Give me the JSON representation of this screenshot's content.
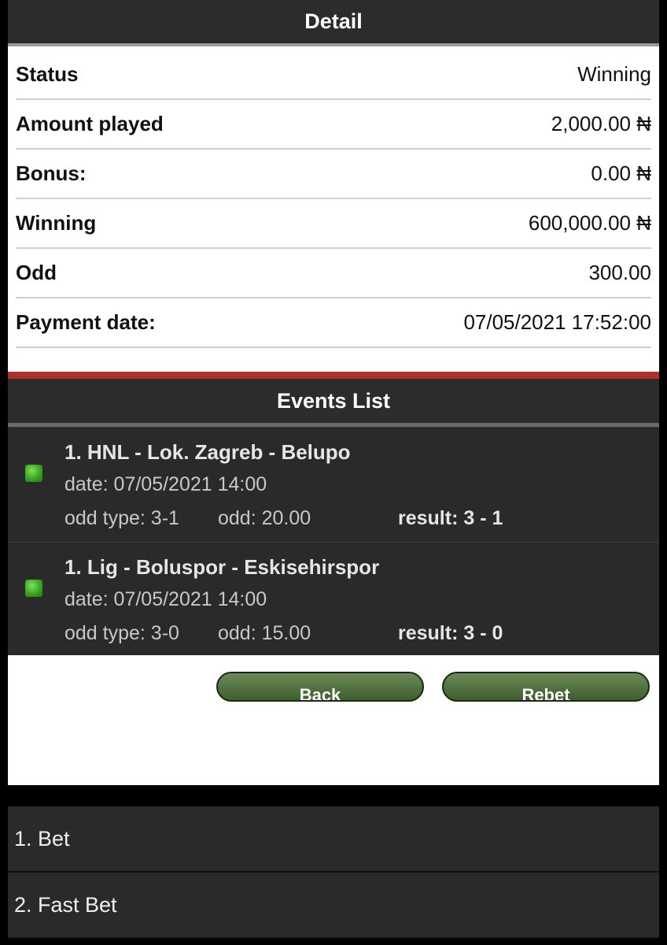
{
  "detail": {
    "title": "Detail",
    "rows": [
      {
        "label": "Status",
        "value": "Winning"
      },
      {
        "label": "Amount played",
        "value": "2,000.00 ₦"
      },
      {
        "label": "Bonus:",
        "value": "0.00 ₦"
      },
      {
        "label": "Winning",
        "value": "600,000.00 ₦"
      },
      {
        "label": "Odd",
        "value": "300.00"
      },
      {
        "label": "Payment date:",
        "value": "07/05/2021 17:52:00"
      }
    ]
  },
  "events": {
    "title": "Events List",
    "items": [
      {
        "title": "1. HNL - Lok. Zagreb - Belupo",
        "date": "date: 07/05/2021 14:00",
        "odd_type": "odd type: 3-1",
        "odd": "odd: 20.00",
        "result": "result: 3 - 1",
        "status_icon": "green-square-icon"
      },
      {
        "title": "1. Lig - Boluspor - Eskisehirspor",
        "date": "date: 07/05/2021 14:00",
        "odd_type": "odd type: 3-0",
        "odd": "odd: 15.00",
        "result": "result: 3 - 0",
        "status_icon": "green-square-icon"
      }
    ]
  },
  "actions": {
    "back_label": "Back",
    "rebet_label": "Rebet"
  },
  "menu": {
    "items": [
      {
        "label": "1. Bet"
      },
      {
        "label": "2. Fast Bet"
      }
    ]
  },
  "colors": {
    "header_bg": "#2d2c2c",
    "accent_red": "#b0302b",
    "button_green": "#4d6d3d",
    "status_green": "#3aa322"
  }
}
